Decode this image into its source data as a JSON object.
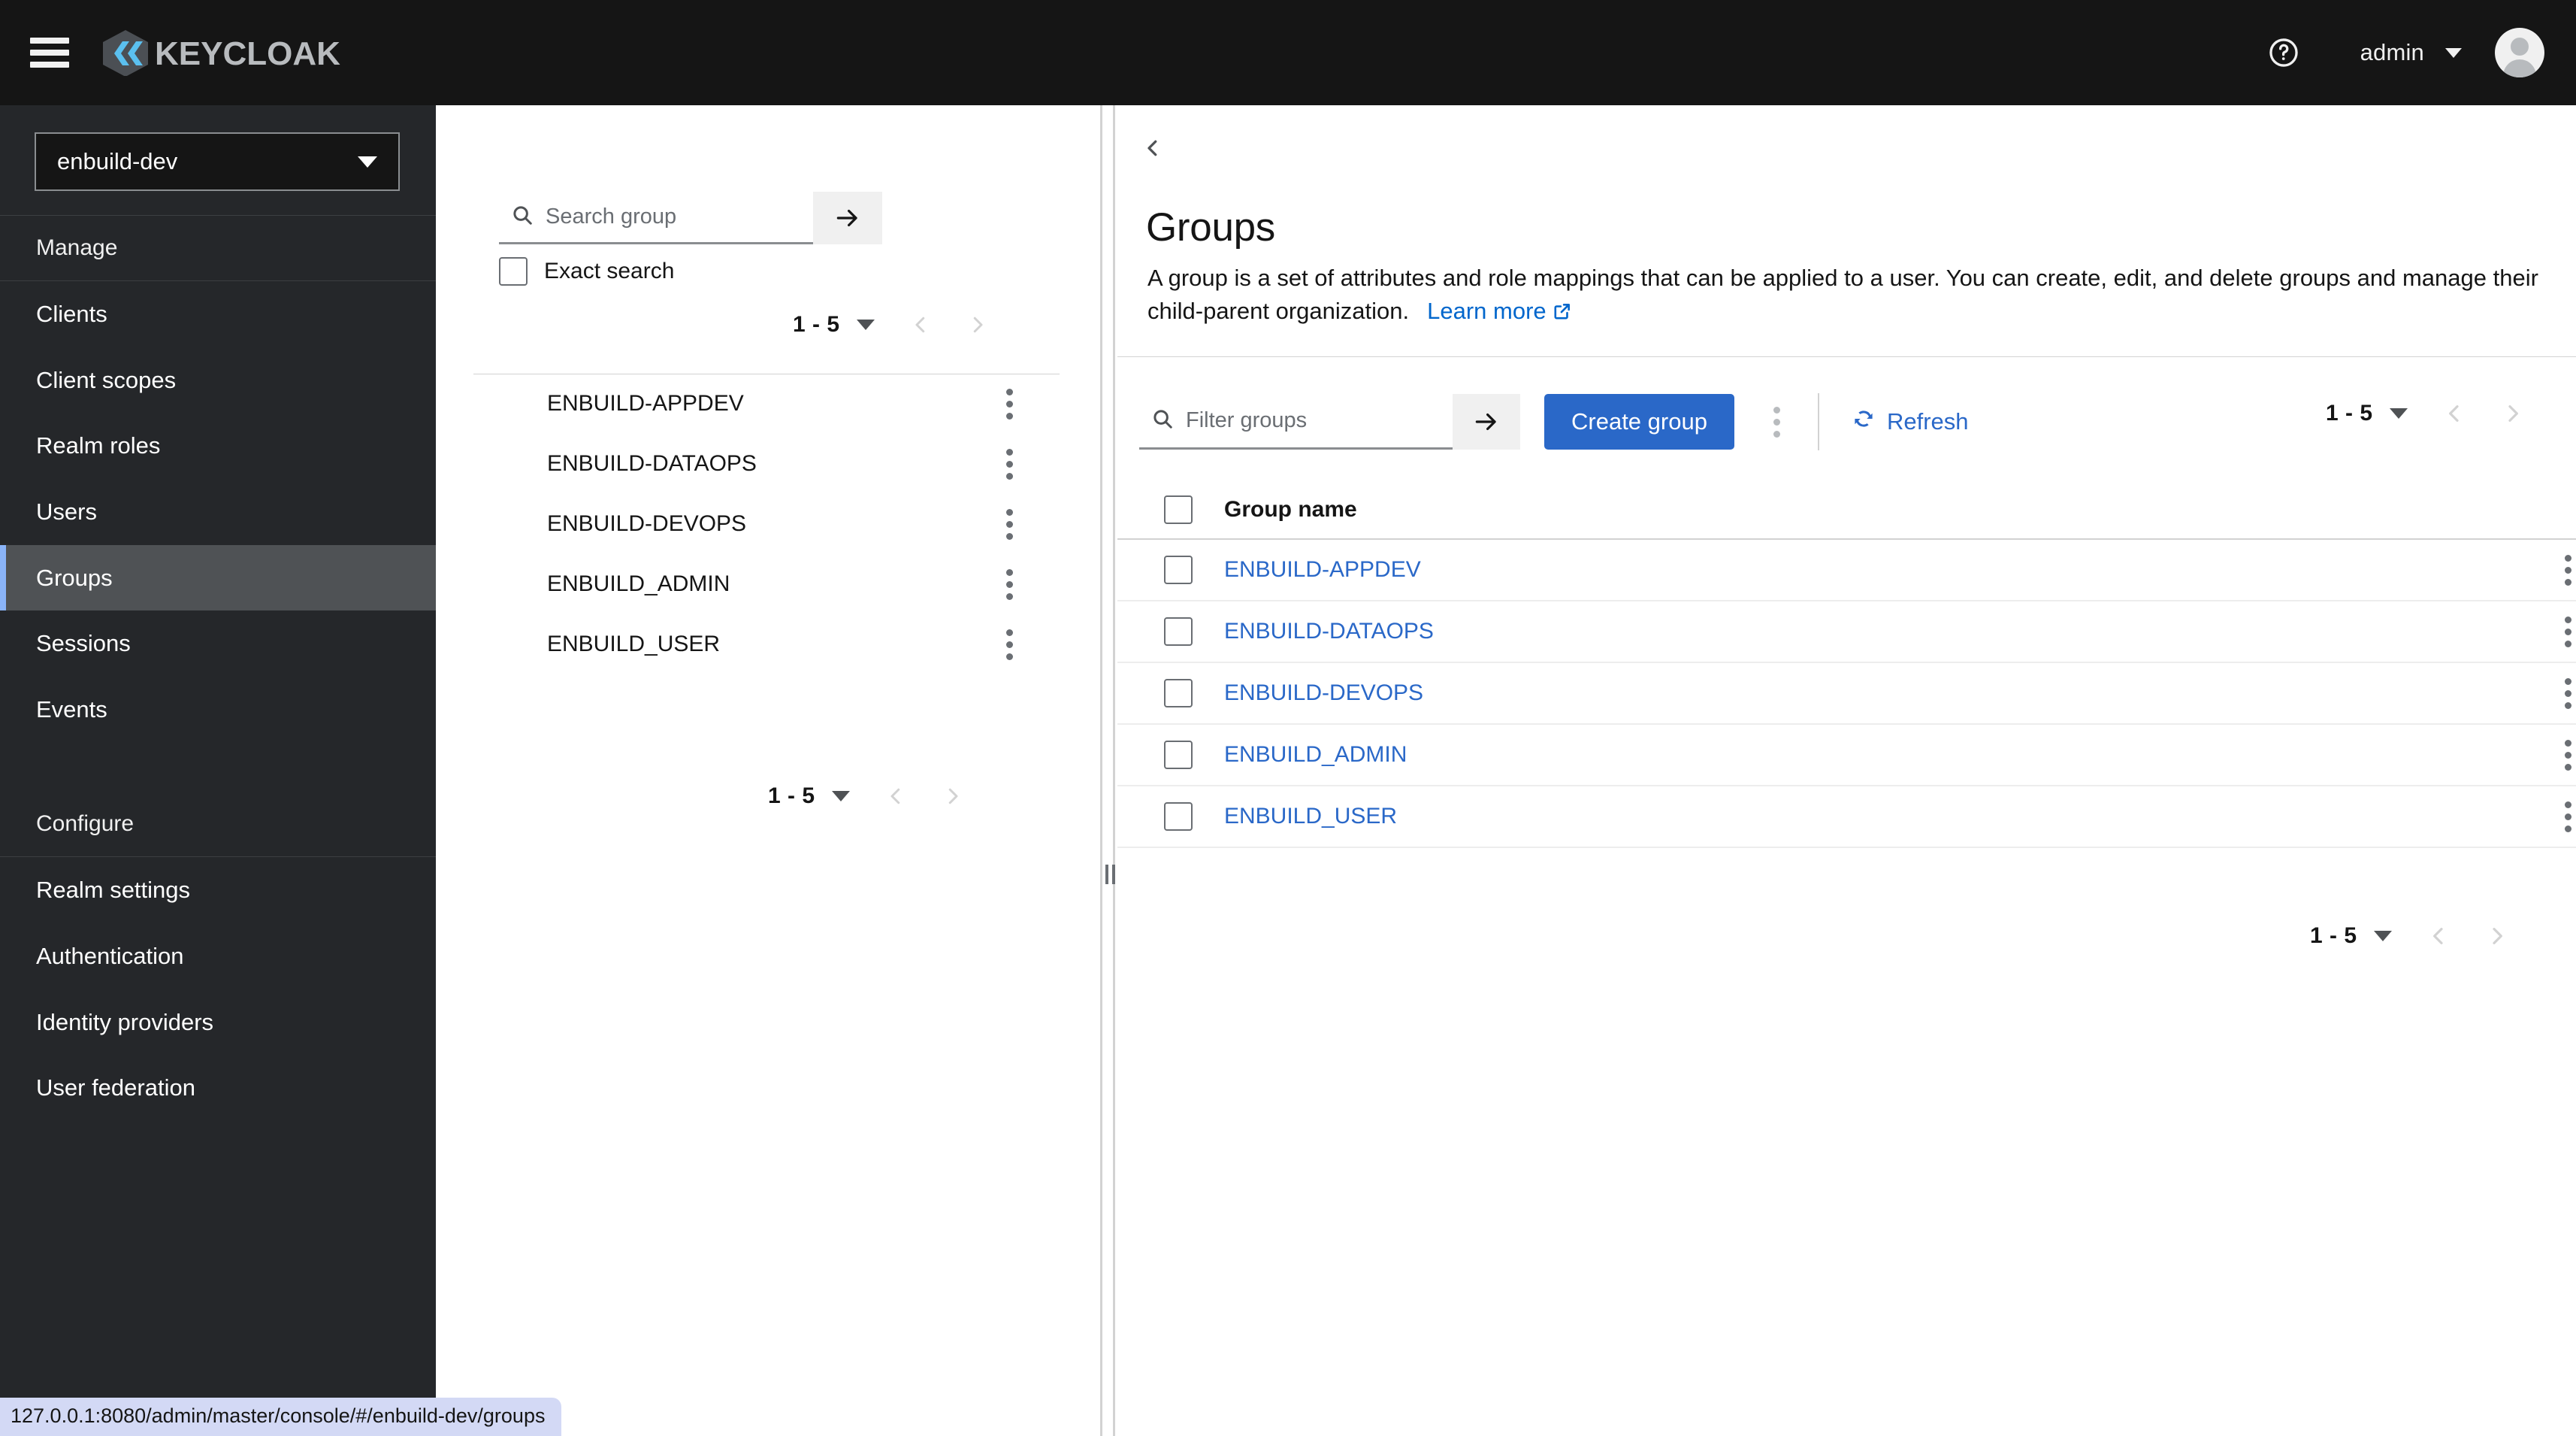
{
  "masthead": {
    "hamburger_icon": "hamburger-menu-icon",
    "brand_name": "KEYCLOAK",
    "help_icon": "help-circle-icon",
    "user_name": "admin",
    "user_caret_icon": "caret-down-icon",
    "avatar_icon": "user-avatar-icon"
  },
  "sidebar": {
    "realm": {
      "selected": "enbuild-dev",
      "caret_icon": "caret-down-icon"
    },
    "sections": [
      {
        "title": "Manage",
        "items": [
          {
            "label": "Clients",
            "active": false
          },
          {
            "label": "Client scopes",
            "active": false
          },
          {
            "label": "Realm roles",
            "active": false
          },
          {
            "label": "Users",
            "active": false
          },
          {
            "label": "Groups",
            "active": true
          },
          {
            "label": "Sessions",
            "active": false
          },
          {
            "label": "Events",
            "active": false
          }
        ]
      },
      {
        "title": "Configure",
        "items": [
          {
            "label": "Realm settings",
            "active": false
          },
          {
            "label": "Authentication",
            "active": false
          },
          {
            "label": "Identity providers",
            "active": false
          },
          {
            "label": "User federation",
            "active": false
          }
        ]
      }
    ]
  },
  "tree_panel": {
    "search": {
      "icon": "search-icon",
      "placeholder": "Search group",
      "value": "",
      "go_icon": "arrow-right-icon"
    },
    "exact_search": {
      "label": "Exact search",
      "checked": false
    },
    "pagination_top": {
      "range": "1 - 5",
      "caret_icon": "caret-down-icon",
      "prev_icon": "chevron-left-icon",
      "next_icon": "chevron-right-icon"
    },
    "items": [
      {
        "label": "ENBUILD-APPDEV",
        "kebab_icon": "kebab-menu-icon"
      },
      {
        "label": "ENBUILD-DATAOPS",
        "kebab_icon": "kebab-menu-icon"
      },
      {
        "label": "ENBUILD-DEVOPS",
        "kebab_icon": "kebab-menu-icon"
      },
      {
        "label": "ENBUILD_ADMIN",
        "kebab_icon": "kebab-menu-icon"
      },
      {
        "label": "ENBUILD_USER",
        "kebab_icon": "kebab-menu-icon"
      }
    ],
    "pagination_bottom": {
      "range": "1 - 5",
      "caret_icon": "caret-down-icon",
      "prev_icon": "chevron-left-icon",
      "next_icon": "chevron-right-icon"
    }
  },
  "main": {
    "back_icon": "chevron-left-icon",
    "title": "Groups",
    "description": "A group is a set of attributes and role mappings that can be applied to a user. You can create, edit, and delete groups and manage their child-parent organization.",
    "learn_more_label": "Learn more",
    "learn_more_icon": "external-link-icon",
    "toolbar": {
      "filter": {
        "icon": "search-icon",
        "placeholder": "Filter groups",
        "value": "",
        "go_icon": "arrow-right-icon"
      },
      "create_label": "Create group",
      "kebab_icon": "kebab-menu-icon",
      "refresh_label": "Refresh",
      "refresh_icon": "sync-refresh-icon",
      "pagination": {
        "range": "1 - 5",
        "caret_icon": "caret-down-icon",
        "prev_icon": "chevron-left-icon",
        "next_icon": "chevron-right-icon"
      }
    },
    "table": {
      "select_all_checked": false,
      "columns": [
        "Group name"
      ],
      "rows": [
        {
          "name": "ENBUILD-APPDEV",
          "checked": false,
          "kebab_icon": "kebab-menu-icon"
        },
        {
          "name": "ENBUILD-DATAOPS",
          "checked": false,
          "kebab_icon": "kebab-menu-icon"
        },
        {
          "name": "ENBUILD-DEVOPS",
          "checked": false,
          "kebab_icon": "kebab-menu-icon"
        },
        {
          "name": "ENBUILD_ADMIN",
          "checked": false,
          "kebab_icon": "kebab-menu-icon"
        },
        {
          "name": "ENBUILD_USER",
          "checked": false,
          "kebab_icon": "kebab-menu-icon"
        }
      ]
    },
    "pagination_bottom": {
      "range": "1 - 5",
      "caret_icon": "caret-down-icon",
      "prev_icon": "chevron-left-icon",
      "next_icon": "chevron-right-icon"
    }
  },
  "statusbar": {
    "url": "127.0.0.1:8080/admin/master/console/#/enbuild-dev/groups"
  },
  "colors": {
    "masthead_bg": "#151515",
    "sidebar_bg": "#25272a",
    "nav_active_bg": "#4f5255",
    "nav_active_accent": "#8ab4f8",
    "primary_blue": "#2a68c8",
    "link_blue": "#0066cc",
    "statusbar_bg": "#d3d9f5"
  }
}
